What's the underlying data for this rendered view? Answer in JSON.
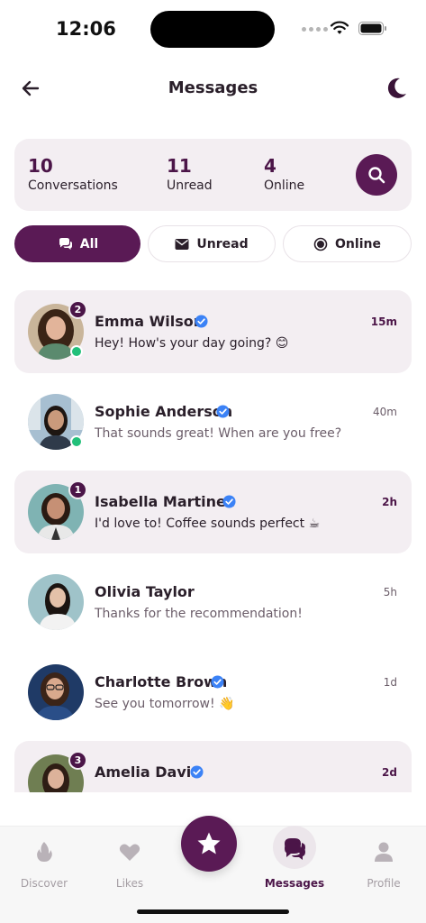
{
  "status_bar": {
    "time": "12:06"
  },
  "header": {
    "title": "Messages"
  },
  "stats": [
    {
      "value": "10",
      "label": "Conversations"
    },
    {
      "value": "11",
      "label": "Unread"
    },
    {
      "value": "4",
      "label": "Online"
    }
  ],
  "filters": [
    {
      "label": "All",
      "icon": "chat-bubbles-icon",
      "active": true
    },
    {
      "label": "Unread",
      "icon": "envelope-icon",
      "active": false
    },
    {
      "label": "Online",
      "icon": "radio-dot-icon",
      "active": false
    }
  ],
  "conversations": [
    {
      "name": "Emma Wilson",
      "message": "Hey! How's your day going? 😊",
      "time": "15m",
      "unread_count": "2",
      "online": true,
      "verified": true,
      "unread": true
    },
    {
      "name": "Sophie Anderson",
      "message": "That sounds great! When are you free?",
      "time": "40m",
      "unread_count": "",
      "online": true,
      "verified": true,
      "unread": false
    },
    {
      "name": "Isabella Martinez",
      "message": "I'd love to! Coffee sounds perfect ☕",
      "time": "2h",
      "unread_count": "1",
      "online": false,
      "verified": true,
      "unread": true
    },
    {
      "name": "Olivia Taylor",
      "message": "Thanks for the recommendation!",
      "time": "5h",
      "unread_count": "",
      "online": false,
      "verified": false,
      "unread": false
    },
    {
      "name": "Charlotte Brown",
      "message": "See you tomorrow! 👋",
      "time": "1d",
      "unread_count": "",
      "online": false,
      "verified": true,
      "unread": false
    },
    {
      "name": "Amelia Davis",
      "message": "",
      "time": "2d",
      "unread_count": "3",
      "online": false,
      "verified": true,
      "unread": true
    }
  ],
  "bottom_nav": {
    "discover": "Discover",
    "likes": "Likes",
    "messages": "Messages",
    "profile": "Profile"
  },
  "colors": {
    "accent": "#5a1a55",
    "card_bg": "#f3eef2",
    "online": "#22c07a",
    "verified": "#3b82f6"
  }
}
